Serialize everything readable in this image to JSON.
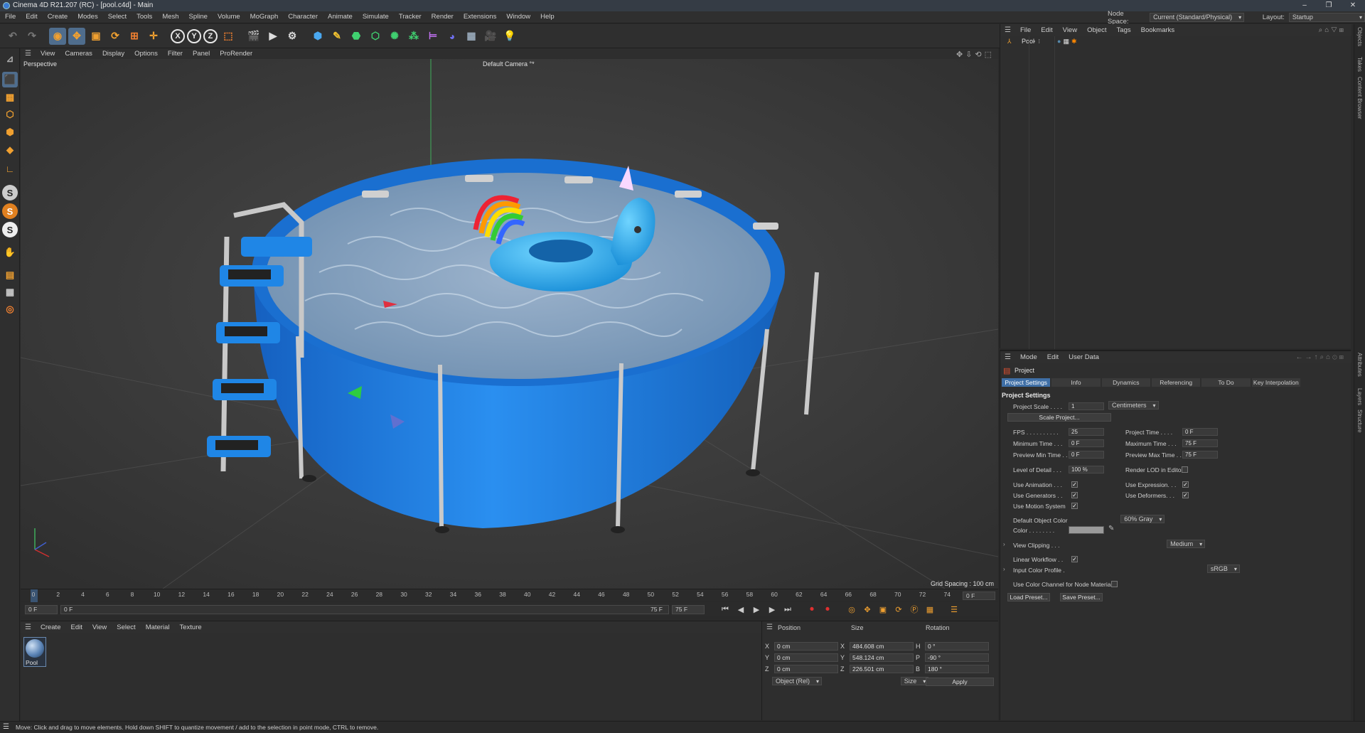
{
  "titlebar": {
    "title": "Cinema 4D R21.207 (RC) - [pool.c4d] - Main",
    "minimize": "–",
    "maximize": "❐",
    "close": "✕"
  },
  "menubar": [
    "File",
    "Edit",
    "Create",
    "Modes",
    "Select",
    "Tools",
    "Mesh",
    "Spline",
    "Volume",
    "MoGraph",
    "Character",
    "Animate",
    "Simulate",
    "Tracker",
    "Render",
    "Extensions",
    "Window",
    "Help"
  ],
  "nodespace": {
    "label": "Node Space:",
    "value": "Current (Standard/Physical)",
    "layout_label": "Layout:",
    "layout_value": "Startup"
  },
  "toolbar": {
    "axis_x": "X",
    "axis_y": "Y",
    "axis_z": "Z"
  },
  "viewport": {
    "menu": [
      "View",
      "Cameras",
      "Display",
      "Options",
      "Filter",
      "Panel",
      "ProRender"
    ],
    "label": "Perspective",
    "camera": "Default Camera °*",
    "grid_spacing": "Grid Spacing : 100 cm"
  },
  "timeline": {
    "ticks": [
      "0",
      "2",
      "4",
      "6",
      "8",
      "10",
      "12",
      "14",
      "16",
      "18",
      "20",
      "22",
      "24",
      "26",
      "28",
      "30",
      "32",
      "34",
      "36",
      "38",
      "40",
      "42",
      "44",
      "46",
      "48",
      "50",
      "52",
      "54",
      "56",
      "58",
      "60",
      "62",
      "64",
      "66",
      "68",
      "70",
      "72",
      "74"
    ],
    "current_frame": "0 F",
    "start_field": "0 F",
    "range_start": "0 F",
    "range_end": "75 F",
    "end_field": "75 F"
  },
  "material_manager": {
    "menu": [
      "Create",
      "Edit",
      "View",
      "Select",
      "Material",
      "Texture"
    ],
    "material_name": "Pool"
  },
  "coordinates": {
    "headers": {
      "position": "Position",
      "size": "Size",
      "rotation": "Rotation"
    },
    "rows": [
      {
        "axis": "X",
        "pos": "0 cm",
        "size_axis": "X",
        "size": "484.608 cm",
        "rot_axis": "H",
        "rot": "0 °"
      },
      {
        "axis": "Y",
        "pos": "0 cm",
        "size_axis": "Y",
        "size": "548.124 cm",
        "rot_axis": "P",
        "rot": "-90 °"
      },
      {
        "axis": "Z",
        "pos": "0 cm",
        "size_axis": "Z",
        "size": "226.501 cm",
        "rot_axis": "B",
        "rot": "180 °"
      }
    ],
    "mode": "Object (Rel)",
    "size_mode": "Size",
    "apply": "Apply"
  },
  "object_manager": {
    "menu": [
      "File",
      "Edit",
      "View",
      "Object",
      "Tags",
      "Bookmarks"
    ],
    "object": "Pool"
  },
  "attributes": {
    "menu": [
      "Mode",
      "Edit",
      "User Data"
    ],
    "title": "Project",
    "tabs": [
      "Project Settings",
      "Info",
      "Dynamics",
      "Referencing",
      "To Do",
      "Key Interpolation"
    ],
    "section": "Project Settings",
    "project_scale_label": "Project Scale . . . .",
    "project_scale_value": "1",
    "project_scale_unit": "Centimeters",
    "scale_project_btn": "Scale Project...",
    "fps_label": "FPS . . . . . . . . . .",
    "fps_value": "25",
    "project_time_label": "Project Time . . . .",
    "project_time_value": "0 F",
    "min_time_label": "Minimum Time . . .",
    "min_time_value": "0 F",
    "max_time_label": "Maximum Time . . .",
    "max_time_value": "75 F",
    "prev_min_label": "Preview Min Time . .",
    "prev_min_value": "0 F",
    "prev_max_label": "Preview Max Time . .",
    "prev_max_value": "75 F",
    "lod_label": "Level of Detail . . .",
    "lod_value": "100 %",
    "render_lod_label": "Render LOD in Editor",
    "use_animation_label": "Use Animation . . .",
    "use_expression_label": "Use Expression. . .",
    "use_generators_label": "Use Generators . .",
    "use_deformers_label": "Use Deformers. . .",
    "use_motion_label": "Use Motion System",
    "default_color_label": "Default Object Color",
    "default_color_value": "60% Gray",
    "color_label": "Color . . . . . . . .",
    "view_clipping_label": "View Clipping . . .",
    "view_clipping_value": "Medium",
    "linear_workflow_label": "Linear Workflow . .",
    "input_color_label": "Input Color Profile .",
    "input_color_value": "sRGB",
    "color_channel_label": "Use Color Channel for Node Material",
    "load_preset": "Load Preset...",
    "save_preset": "Save Preset...",
    "check": "✓"
  },
  "side_tabs": [
    "Objects",
    "Takes",
    "Content Browser",
    "Attributes",
    "Layers",
    "Structure"
  ],
  "statusbar": "Move: Click and drag to move elements. Hold down SHIFT to quantize movement / add to the selection in point mode, CTRL to remove.",
  "colors": {
    "pool_blue": "#1f86e6",
    "water": "#8aa7c4",
    "accent": "#3f6fa6"
  }
}
